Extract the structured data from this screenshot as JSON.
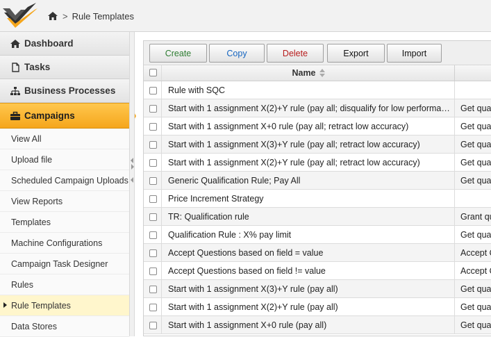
{
  "breadcrumb": {
    "separator": ">",
    "current": "Rule Templates"
  },
  "sidebar": {
    "main_items": [
      {
        "label": "Dashboard",
        "icon": "home-icon"
      },
      {
        "label": "Tasks",
        "icon": "document-icon"
      },
      {
        "label": "Business Processes",
        "icon": "sitemap-icon"
      }
    ],
    "active": {
      "label": "Campaigns",
      "icon": "briefcase-icon"
    },
    "sub_items": [
      "View All",
      "Upload file",
      "Scheduled Campaign Uploads",
      "View Reports",
      "Templates",
      "Machine Configurations",
      "Campaign Task Designer",
      "Rules",
      "Rule Templates",
      "Data Stores"
    ],
    "selected_sub": "Rule Templates"
  },
  "toolbar": {
    "create": "Create",
    "copy": "Copy",
    "delete": "Delete",
    "export": "Export",
    "import": "Import"
  },
  "table": {
    "name_header": "Name",
    "rows": [
      {
        "name": "Rule with SQC",
        "desc": ""
      },
      {
        "name": "Start with 1 assignment X(2)+Y rule (pay all; disqualify for low performan…",
        "desc": "Get qual"
      },
      {
        "name": "Start with 1 assignment X+0 rule (pay all; retract low accuracy)",
        "desc": "Get qual"
      },
      {
        "name": "Start with 1 assignment X(3)+Y rule (pay all; retract low accuracy)",
        "desc": "Get qual"
      },
      {
        "name": "Start with 1 assignment X(2)+Y rule (pay all; retract low accuracy)",
        "desc": "Get qual"
      },
      {
        "name": "Generic Qualification Rule; Pay All",
        "desc": "Get qual"
      },
      {
        "name": "Price Increment Strategy",
        "desc": ""
      },
      {
        "name": "TR: Qualification rule",
        "desc": "Grant qu"
      },
      {
        "name": "Qualification Rule : X% pay limit",
        "desc": "Get qual"
      },
      {
        "name": "Accept Questions based on field = value",
        "desc": "Accept Q"
      },
      {
        "name": "Accept Questions based on field != value",
        "desc": "Accept Q"
      },
      {
        "name": "Start with 1 assignment X(3)+Y rule (pay all)",
        "desc": "Get qual"
      },
      {
        "name": "Start with 1 assignment X(2)+Y rule (pay all)",
        "desc": "Get qual"
      },
      {
        "name": "Start with 1 assignment X+0 rule (pay all)",
        "desc": "Get qual"
      }
    ]
  }
}
